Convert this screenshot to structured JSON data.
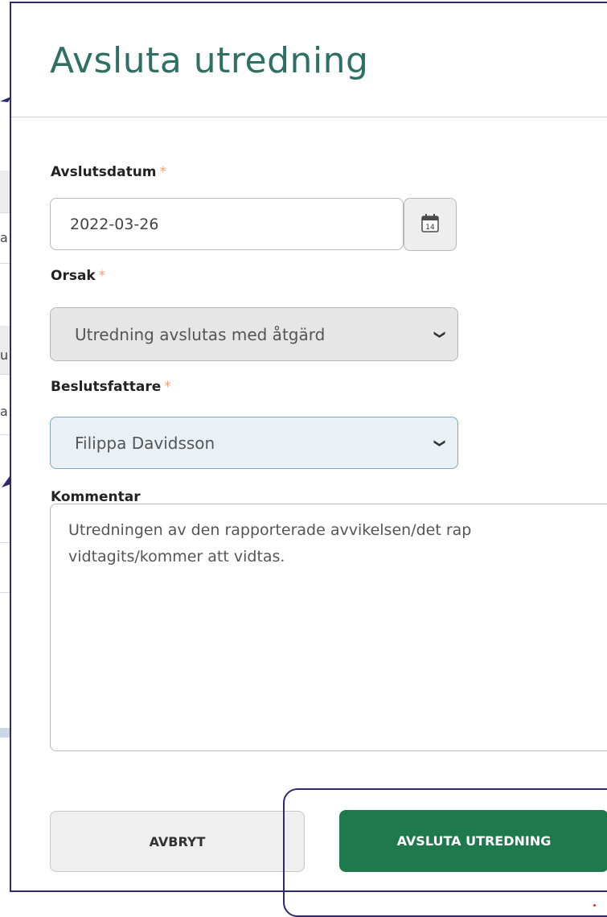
{
  "dialog": {
    "title": "Avsluta utredning",
    "avslutsdatum": {
      "label": "Avslutsdatum",
      "value": "2022-03-26",
      "calendar_day": "14"
    },
    "orsak": {
      "label": "Orsak",
      "value": "Utredning avslutas med åtgärd"
    },
    "beslutsfattare": {
      "label": "Beslutsfattare",
      "value": "Filippa Davidsson"
    },
    "kommentar": {
      "label": "Kommentar",
      "value": "Utredningen av den rapporterade avvikelsen/det rap\nvidtagits/kommer att vidtas."
    },
    "required_marker": "*",
    "buttons": {
      "cancel": "AVBRYT",
      "submit": "AVSLUTA UTREDNING"
    }
  },
  "background": {
    "letters": [
      "a",
      "u",
      "a"
    ]
  },
  "colors": {
    "title": "#2e7064",
    "submit": "#1e7a4c",
    "required": "#f0a070",
    "annotation": "#2f2a6e"
  }
}
